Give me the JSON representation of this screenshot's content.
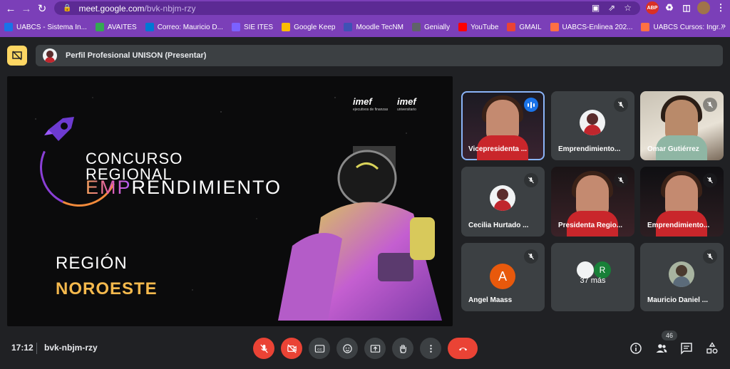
{
  "browser": {
    "url_host": "meet.google.com",
    "url_path": "/bvk-nbjm-rzy",
    "bookmarks": [
      {
        "label": "UABCS - Sistema In...",
        "color": "#1a73e8"
      },
      {
        "label": "AVAITES",
        "color": "#34a853"
      },
      {
        "label": "Correo: Mauricio D...",
        "color": "#0078d4"
      },
      {
        "label": "SIE ITES",
        "color": "#7b61ff"
      },
      {
        "label": "Google Keep",
        "color": "#fbbc04"
      },
      {
        "label": "Moodle TecNM",
        "color": "#3f51b5"
      },
      {
        "label": "Genially",
        "color": "#5f6368"
      },
      {
        "label": "YouTube",
        "color": "#ff0000"
      },
      {
        "label": "GMAIL",
        "color": "#ea4335"
      },
      {
        "label": "UABCS-Enlinea 202...",
        "color": "#ff7043"
      },
      {
        "label": "UABCS Cursos: Ingr...",
        "color": "#ff7043"
      }
    ],
    "more_label": "»"
  },
  "presentation": {
    "presenter_label": "Perfil Profesional UNISON (Presentar)"
  },
  "slide": {
    "line1": "CONCURSO",
    "line2": "REGIONAL",
    "line3_a": "EMP",
    "line3_b": "RENDIMIENTO",
    "region": "REGIÓN",
    "region_name": "NOROESTE",
    "logo1": "imef",
    "logo1_sub": "ejecutivos de finanzas",
    "logo2": "imef",
    "logo2_sub": "universitario"
  },
  "participants": [
    {
      "name": "Vicepresidenta ...",
      "state": "speaking"
    },
    {
      "name": "Emprendimiento...",
      "state": "muted"
    },
    {
      "name": "Omar Gutiérrez",
      "state": "muted"
    },
    {
      "name": "Cecilia Hurtado ...",
      "state": "muted"
    },
    {
      "name": "Presidenta Regio...",
      "state": "muted"
    },
    {
      "name": "Emprendimiento...",
      "state": "muted"
    },
    {
      "name": "Angel Maass",
      "state": "muted",
      "initial": "A"
    },
    {
      "name": "37 más",
      "initial": "R"
    },
    {
      "name": "Mauricio Daniel ...",
      "state": "muted"
    }
  ],
  "footer": {
    "time": "17:12",
    "meeting_code": "bvk-nbjm-rzy",
    "people_count": "46"
  }
}
